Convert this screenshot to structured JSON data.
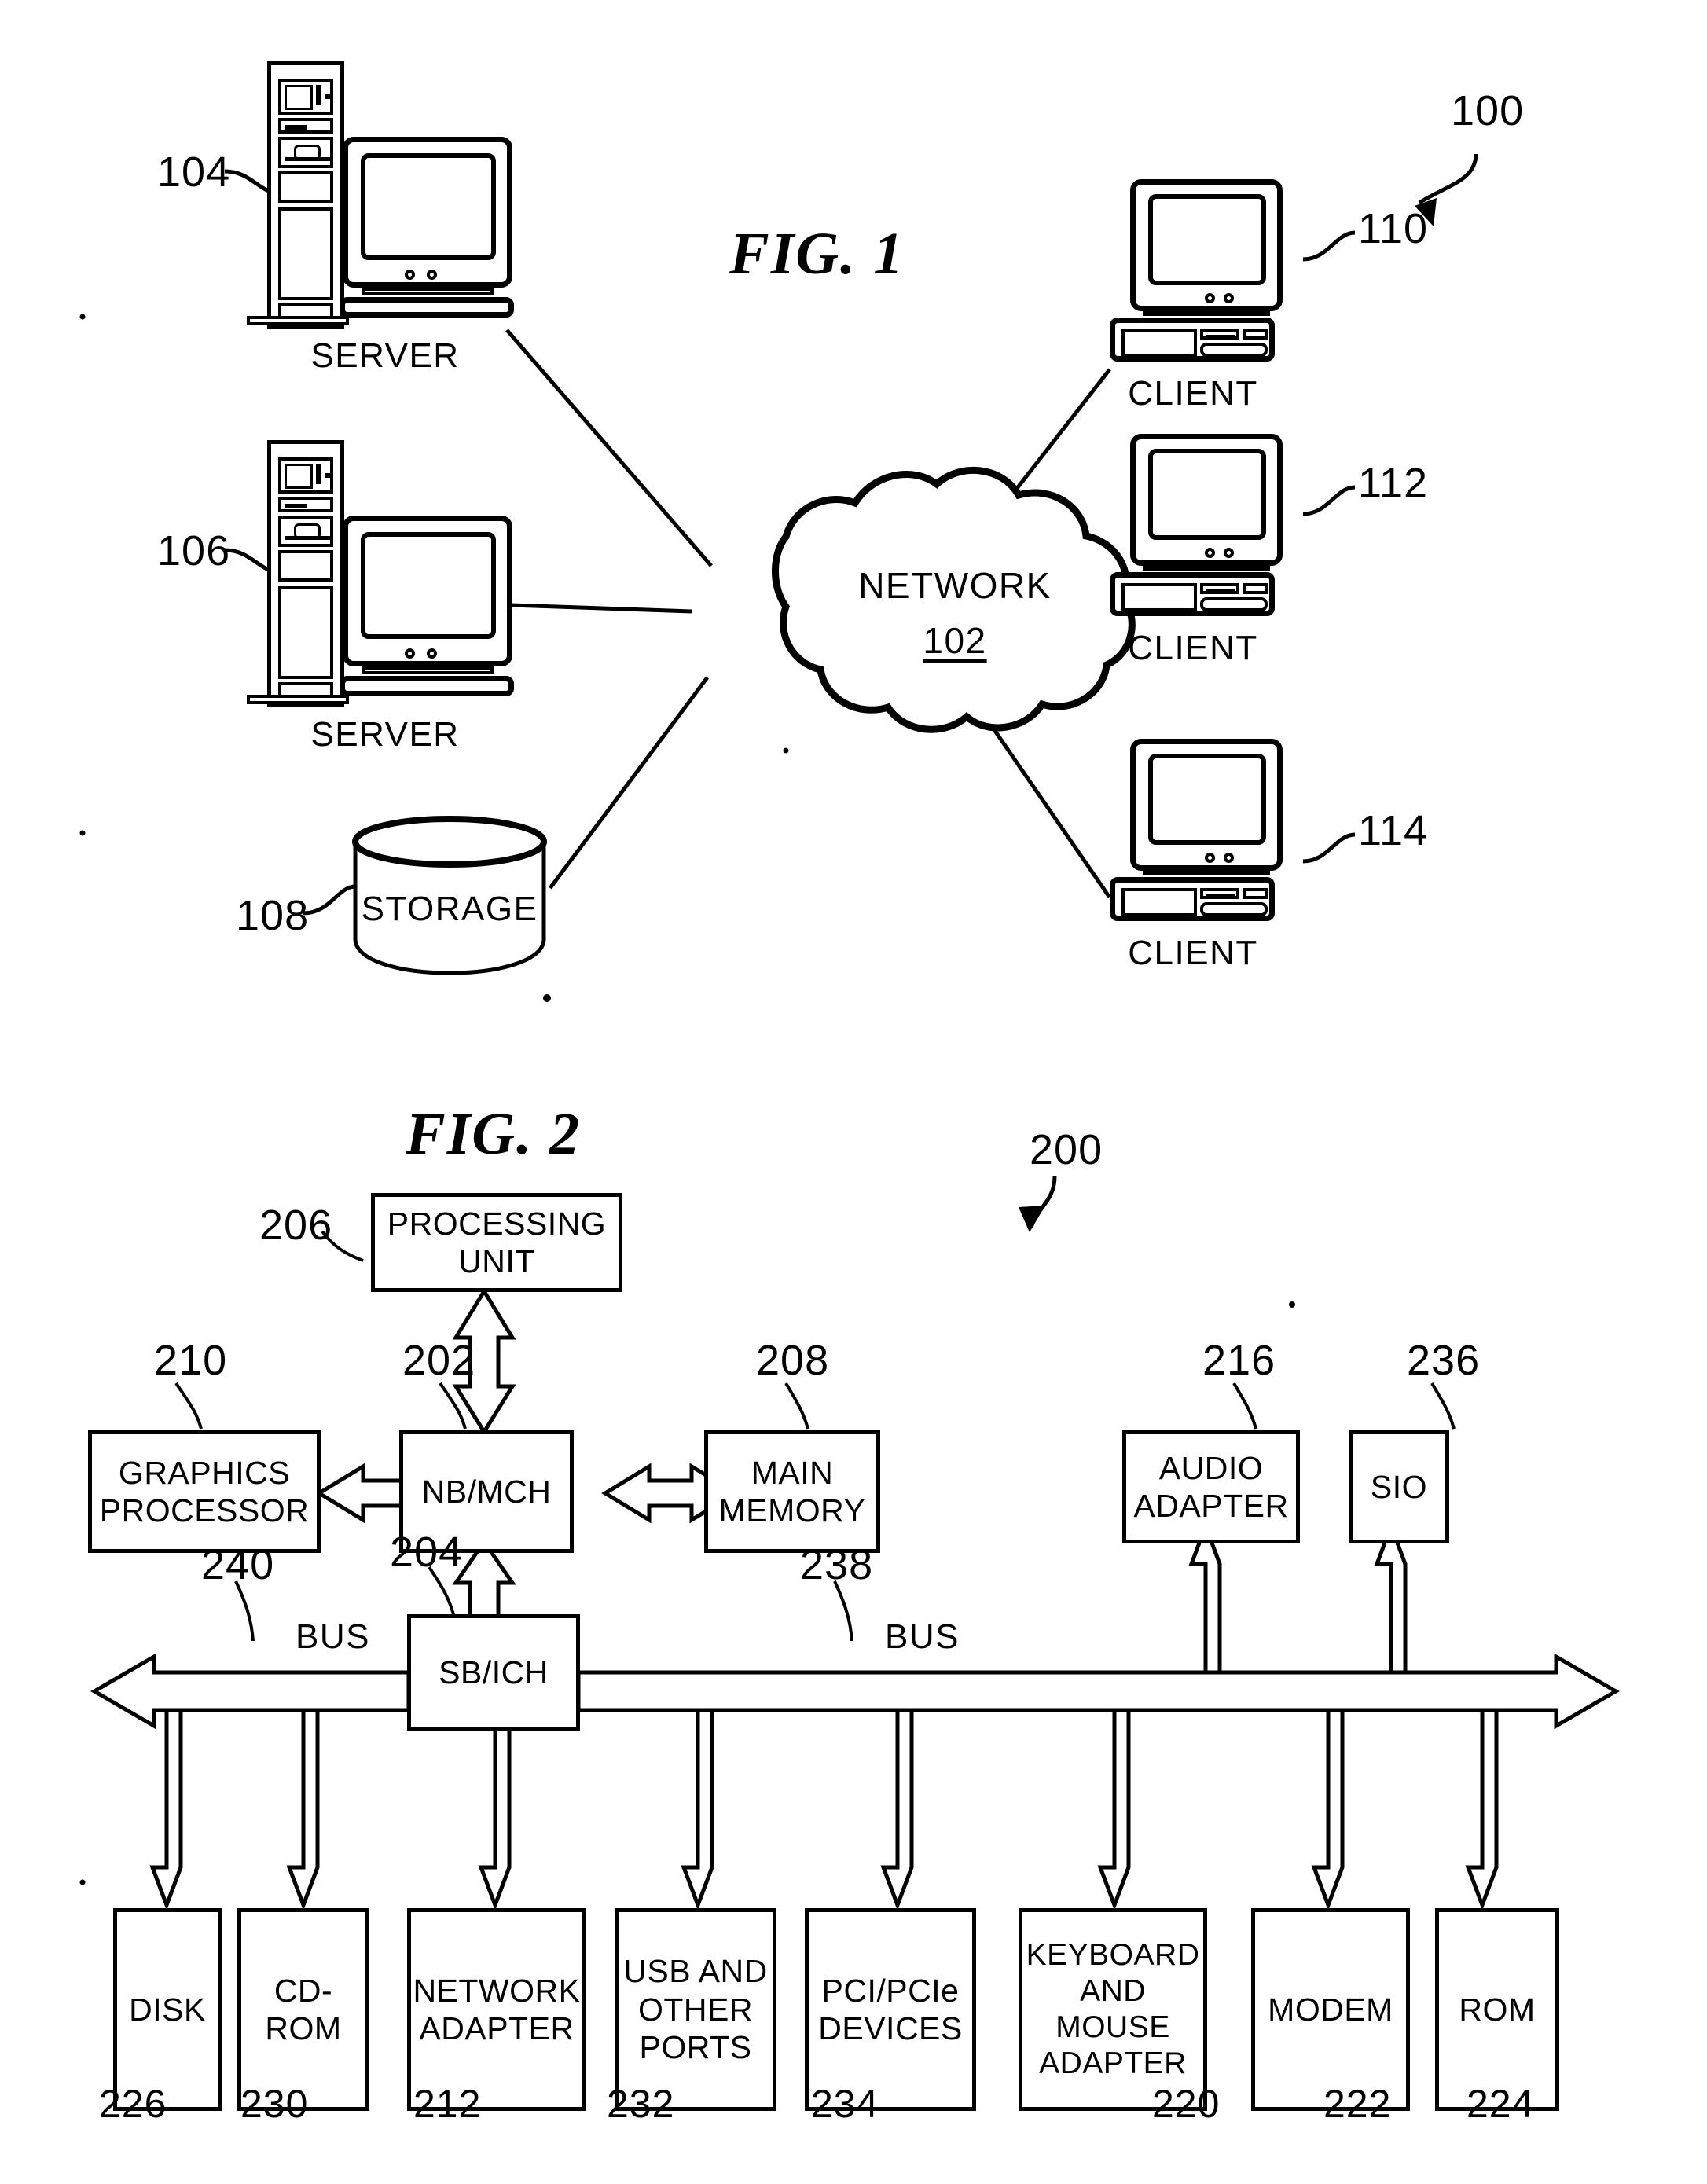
{
  "figures": [
    {
      "id": "fig1",
      "title": "FIG. 1",
      "system_ref": "100",
      "nodes": {
        "server_top": {
          "ref": "104",
          "caption": "SERVER"
        },
        "server_bottom": {
          "ref": "106",
          "caption": "SERVER"
        },
        "storage": {
          "ref": "108",
          "caption": "STORAGE"
        },
        "network": {
          "label": "NETWORK",
          "ref": "102"
        },
        "client_top": {
          "ref": "110",
          "caption": "CLIENT"
        },
        "client_mid": {
          "ref": "112",
          "caption": "CLIENT"
        },
        "client_bottom": {
          "ref": "114",
          "caption": "CLIENT"
        }
      }
    },
    {
      "id": "fig2",
      "title": "FIG. 2",
      "system_ref": "200",
      "blocks": {
        "processing_unit": {
          "ref": "206",
          "label": "PROCESSING\nUNIT"
        },
        "graphics_processor": {
          "ref": "210",
          "label": "GRAPHICS\nPROCESSOR"
        },
        "nb_mch": {
          "ref": "202",
          "label": "NB/MCH"
        },
        "main_memory": {
          "ref": "208",
          "label": "MAIN\nMEMORY"
        },
        "audio_adapter": {
          "ref": "216",
          "label": "AUDIO\nADAPTER"
        },
        "sio": {
          "ref": "236",
          "label": "SIO"
        },
        "sb_ich": {
          "ref": "204",
          "label": "SB/ICH"
        },
        "bus_left": {
          "ref": "240",
          "label": "BUS"
        },
        "bus_right": {
          "ref": "238",
          "label": "BUS"
        }
      },
      "peripherals": [
        {
          "ref": "226",
          "label": "DISK"
        },
        {
          "ref": "230",
          "label": "CD-ROM"
        },
        {
          "ref": "212",
          "label": "NETWORK\nADAPTER"
        },
        {
          "ref": "232",
          "label": "USB AND\nOTHER\nPORTS"
        },
        {
          "ref": "234",
          "label": "PCI/PCIe\nDEVICES"
        },
        {
          "ref": "220",
          "label": "KEYBOARD\nAND\nMOUSE\nADAPTER"
        },
        {
          "ref": "222",
          "label": "MODEM"
        },
        {
          "ref": "224",
          "label": "ROM"
        }
      ]
    }
  ],
  "colors": {
    "ink": "#000000",
    "paper": "#ffffff"
  }
}
